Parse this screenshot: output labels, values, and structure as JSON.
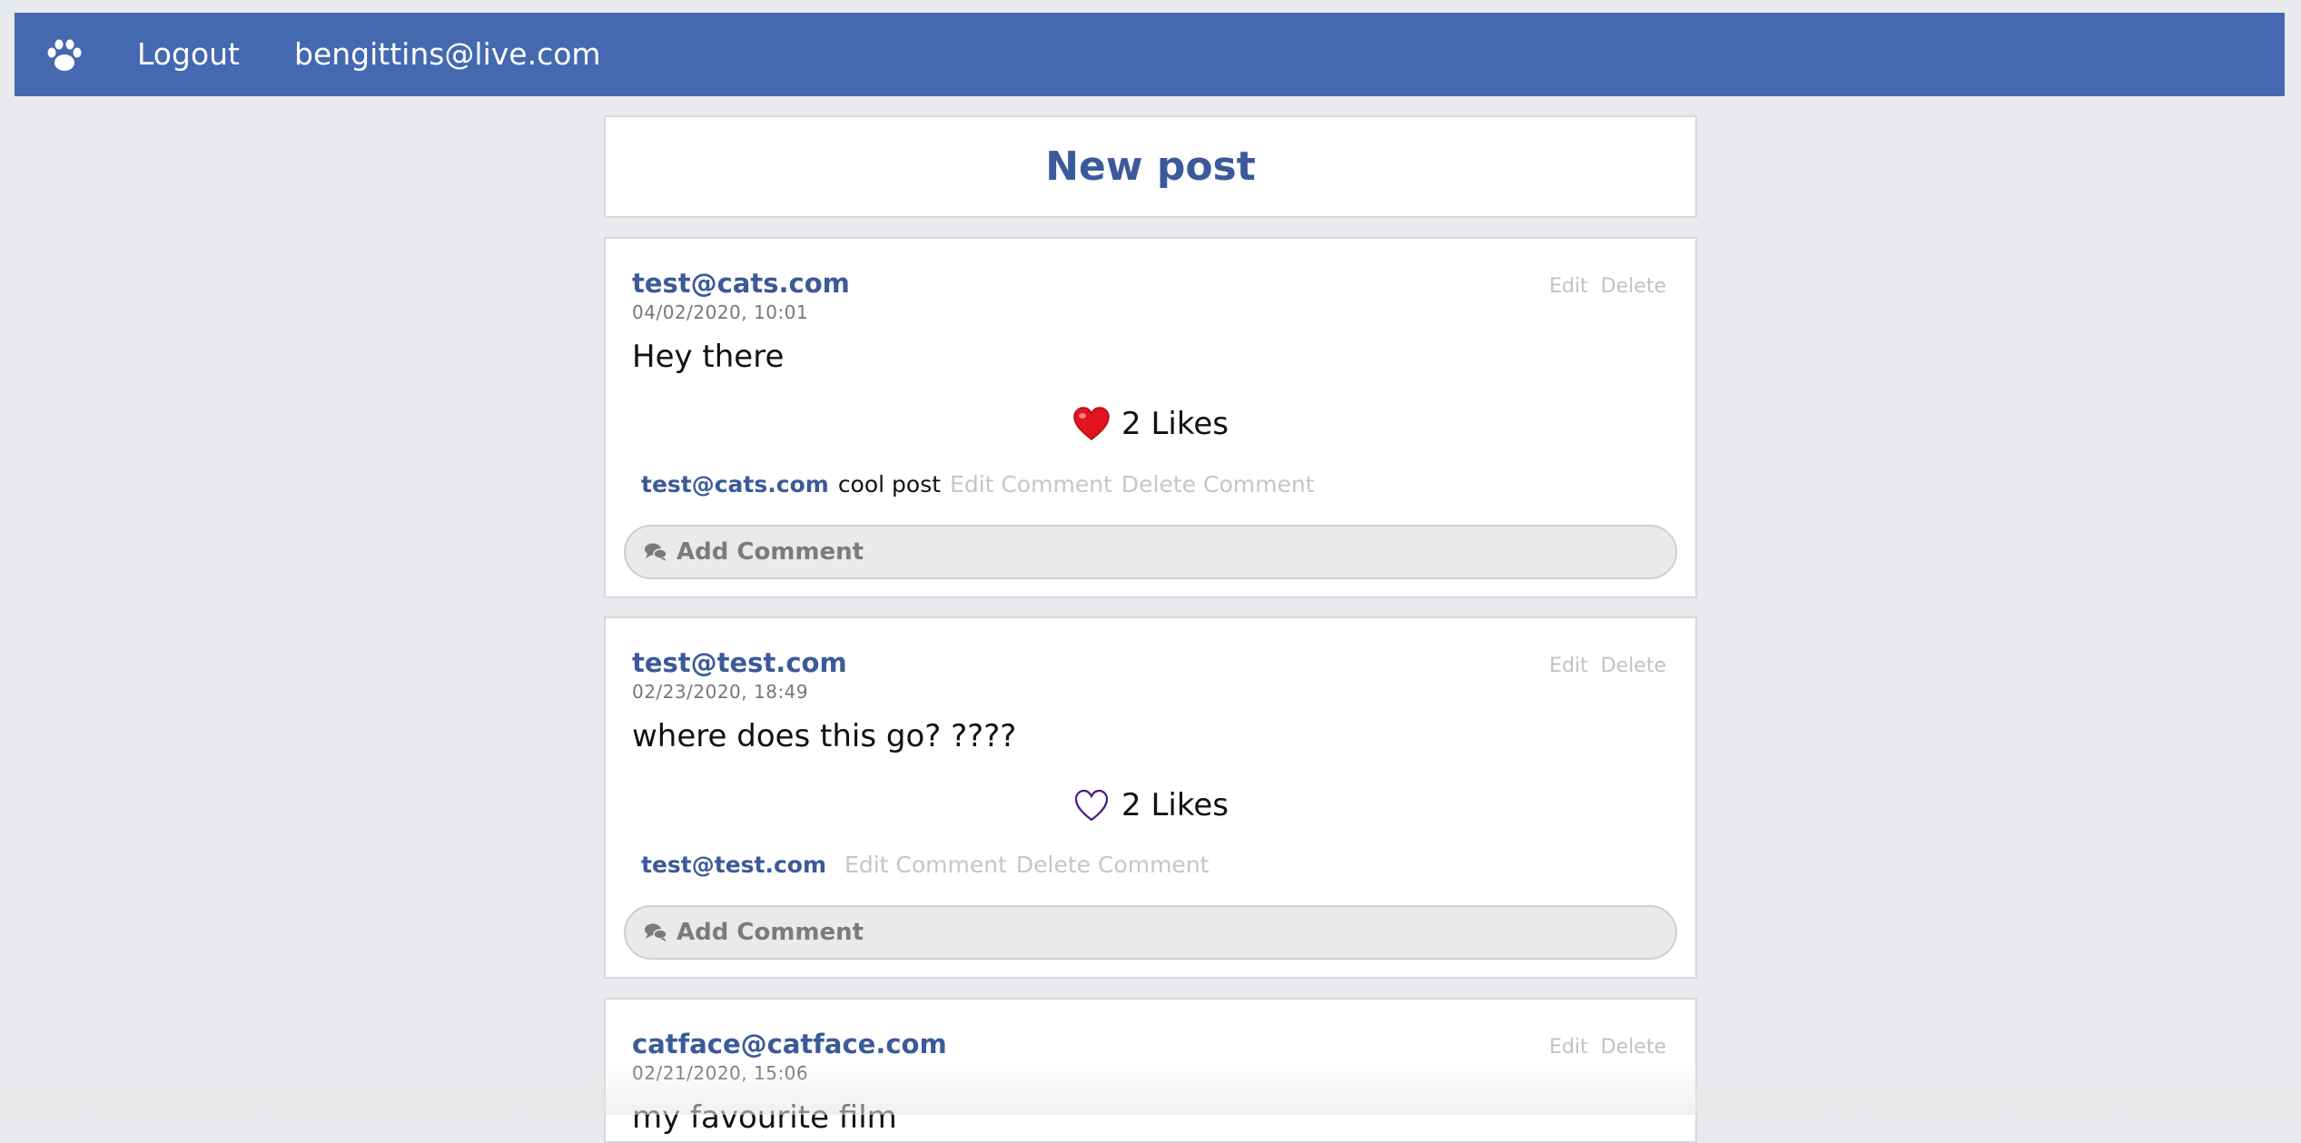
{
  "nav": {
    "logo_icon": "paw-icon",
    "logout": "Logout",
    "user_email": "bengittins@live.com"
  },
  "new_post": "New post",
  "posts": [
    {
      "author": "test@cats.com",
      "date": "04/02/2020, 10:01",
      "edit": "Edit",
      "delete": "Delete",
      "text": "Hey there",
      "liked": true,
      "likes": "2 Likes",
      "comment": {
        "author": "test@cats.com",
        "text": "cool post",
        "edit": "Edit Comment",
        "delete": "Delete Comment"
      },
      "add_comment": "Add Comment"
    },
    {
      "author": "test@test.com",
      "date": "02/23/2020, 18:49",
      "edit": "Edit",
      "delete": "Delete",
      "text": "where does this go? ????",
      "liked": false,
      "likes": "2 Likes",
      "comment": {
        "author": "test@test.com",
        "text": "",
        "edit": "Edit Comment",
        "delete": "Delete Comment"
      },
      "add_comment": "Add Comment"
    },
    {
      "author": "catface@catface.com",
      "date": "02/21/2020, 15:06",
      "edit": "Edit",
      "delete": "Delete",
      "text": "my favourite film"
    }
  ],
  "colors": {
    "navbar": "#4469b1",
    "link": "#3c5a99",
    "background": "#e9eaed",
    "heart_filled": "#e0141e",
    "heart_outline": "#4b1a8a"
  }
}
